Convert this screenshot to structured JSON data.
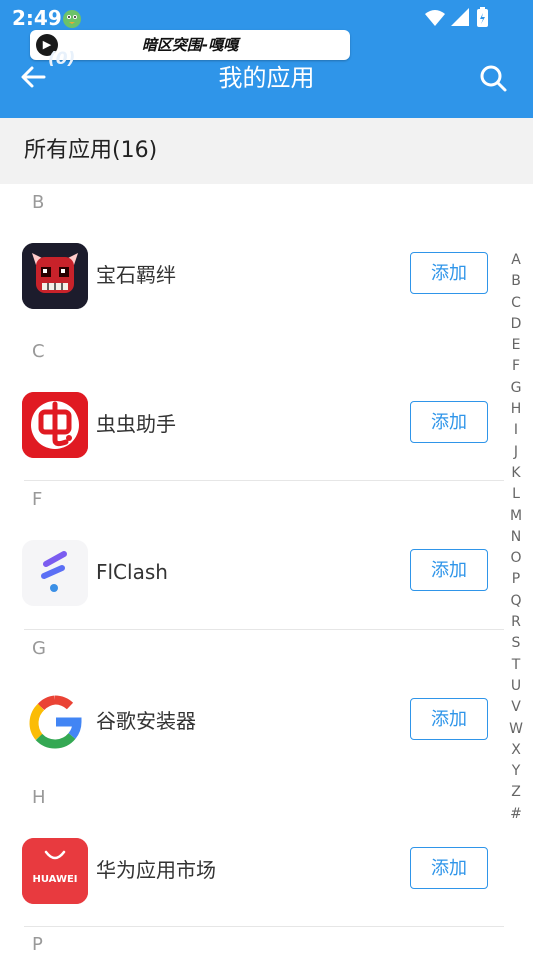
{
  "status_bar": {
    "time": "2:49",
    "bird_icon": "bird-app-icon"
  },
  "media": {
    "title": "暗区突围-嘎嘎",
    "play_icon": "play-icon"
  },
  "app_bar": {
    "title": "我的应用",
    "back_badge": "(0)",
    "color": "#2f95e9"
  },
  "list": {
    "header": "所有应用(16)",
    "sections": [
      {
        "letter": "B",
        "apps": [
          {
            "name": "宝石羁绊",
            "action": "添加"
          }
        ]
      },
      {
        "letter": "C",
        "apps": [
          {
            "name": "虫虫助手",
            "action": "添加"
          }
        ]
      },
      {
        "letter": "F",
        "apps": [
          {
            "name": "FlClash",
            "action": "添加"
          }
        ]
      },
      {
        "letter": "G",
        "apps": [
          {
            "name": "谷歌安装器",
            "action": "添加"
          }
        ]
      },
      {
        "letter": "H",
        "apps": [
          {
            "name": "华为应用市场",
            "action": "添加",
            "icon_text": "HUAWEI"
          }
        ]
      },
      {
        "letter": "P"
      }
    ]
  },
  "index_letters": [
    "A",
    "B",
    "C",
    "D",
    "E",
    "F",
    "G",
    "H",
    "I",
    "J",
    "K",
    "L",
    "M",
    "N",
    "O",
    "P",
    "Q",
    "R",
    "S",
    "T",
    "U",
    "V",
    "W",
    "X",
    "Y",
    "Z",
    "#"
  ]
}
